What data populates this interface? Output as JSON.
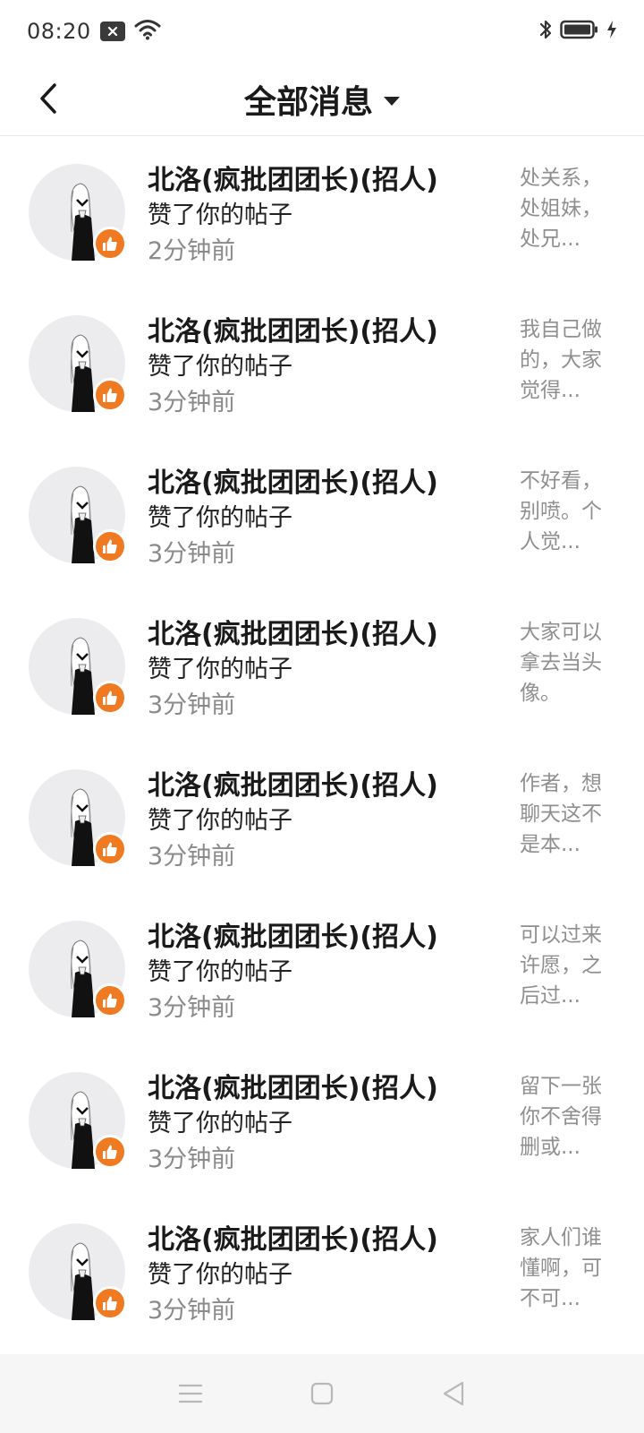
{
  "status": {
    "time": "08:20",
    "icons": [
      "notification-close-icon",
      "wifi-icon",
      "bluetooth-icon",
      "battery-icon",
      "charging-icon"
    ]
  },
  "header": {
    "title": "全部消息",
    "back_icon": "chevron-left-icon",
    "dropdown_icon": "caret-down-icon"
  },
  "colors": {
    "like_badge": "#f07a22",
    "avatar_bg": "#ececef",
    "secondary_text": "#8a8a8a"
  },
  "messages": [
    {
      "name": "北洛(疯批团团长)(招人)",
      "action": "赞了你的帖子",
      "time": "2分钟前",
      "preview": [
        "处关系，",
        "处姐妹，",
        "处兄..."
      ]
    },
    {
      "name": "北洛(疯批团团长)(招人)",
      "action": "赞了你的帖子",
      "time": "3分钟前",
      "preview": [
        "我自己做",
        "的，大家",
        "觉得..."
      ]
    },
    {
      "name": "北洛(疯批团团长)(招人)",
      "action": "赞了你的帖子",
      "time": "3分钟前",
      "preview": [
        "不好看，",
        "别喷。个",
        "人觉..."
      ]
    },
    {
      "name": "北洛(疯批团团长)(招人)",
      "action": "赞了你的帖子",
      "time": "3分钟前",
      "preview": [
        "大家可以",
        "拿去当头",
        "像。"
      ]
    },
    {
      "name": "北洛(疯批团团长)(招人)",
      "action": "赞了你的帖子",
      "time": "3分钟前",
      "preview": [
        "作者，想",
        "聊天这不",
        "是本..."
      ]
    },
    {
      "name": "北洛(疯批团团长)(招人)",
      "action": "赞了你的帖子",
      "time": "3分钟前",
      "preview": [
        "可以过来",
        "许愿，之",
        "后过..."
      ]
    },
    {
      "name": "北洛(疯批团团长)(招人)",
      "action": "赞了你的帖子",
      "time": "3分钟前",
      "preview": [
        "留下一张",
        "你不舍得",
        "删或..."
      ]
    },
    {
      "name": "北洛(疯批团团长)(招人)",
      "action": "赞了你的帖子",
      "time": "3分钟前",
      "preview": [
        "家人们谁",
        "懂啊，可",
        "不可..."
      ]
    }
  ],
  "navbar": {
    "icons": [
      "menu-icon",
      "home-square-icon",
      "back-triangle-icon"
    ]
  }
}
